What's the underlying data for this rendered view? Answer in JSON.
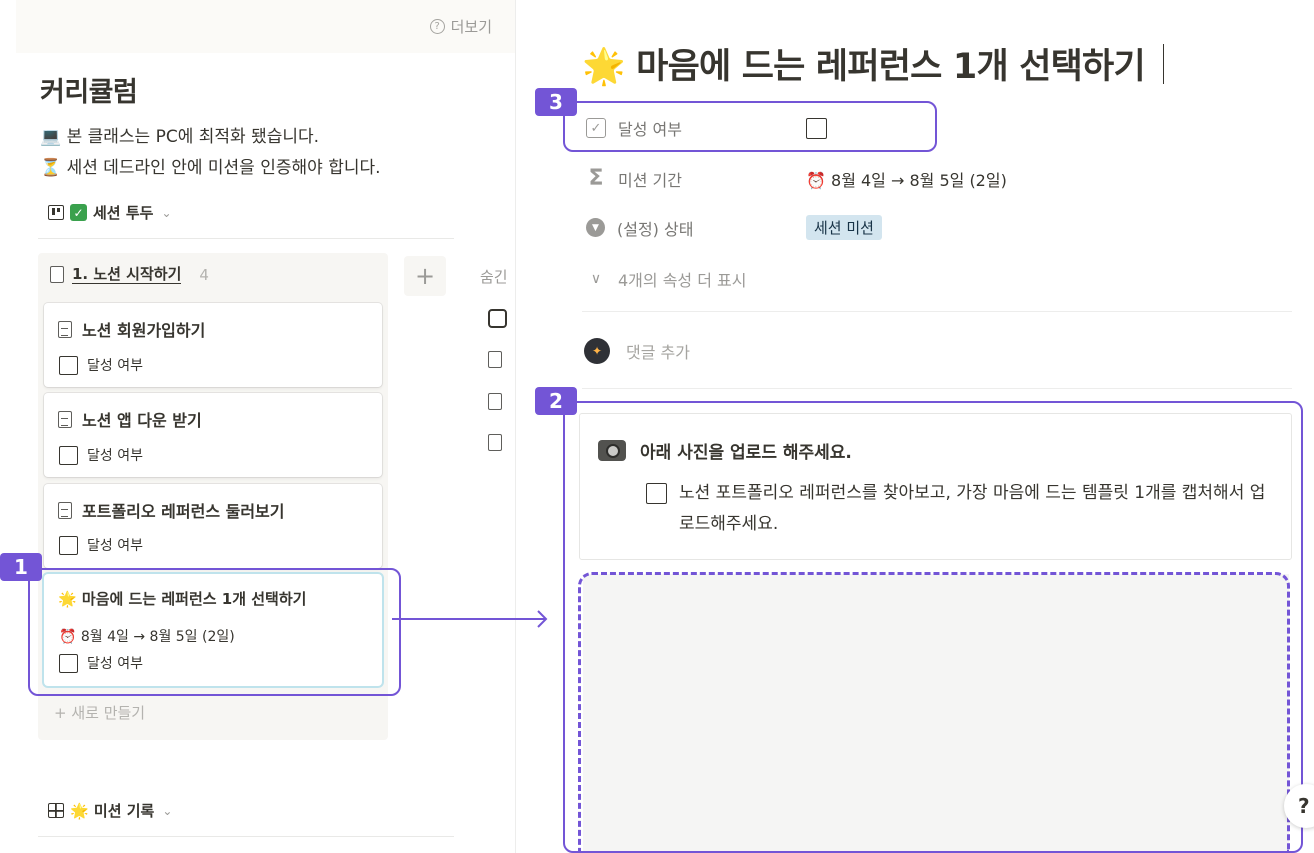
{
  "left": {
    "topbar": {
      "more_label": "더보기"
    },
    "title": "커리큘럼",
    "desc1": "💻 본 클래스는 PC에 최적화 됐습니다.",
    "desc2": "⏳ 세션 데드라인 안에 미션을 인증해야 합니다.",
    "view1": {
      "label": "세션 투두",
      "icon": "board-icon"
    },
    "view2": {
      "label": "🌟 미션 기록",
      "icon": "gallery-icon"
    },
    "column": {
      "label": "1. 노션 시작하기",
      "count": "4"
    },
    "cards": [
      {
        "title": "노션 회원가입하기",
        "prop": "달성 여부"
      },
      {
        "title": "노션 앱 다운 받기",
        "prop": "달성 여부"
      },
      {
        "title": "포트폴리오 레퍼런스 둘러보기",
        "prop": "달성 여부"
      },
      {
        "title": "🌟 마음에 드는 레퍼런스 1개 선택하기",
        "date": "⏰ 8월 4일 → 8월 5일 (2일)",
        "prop": "달성 여부"
      }
    ],
    "new_label": "+ 새로 만들기",
    "hidden_label": "숨긴"
  },
  "annotations": {
    "b1": "1",
    "b2": "2",
    "b3": "3",
    "accent": "#7355d6"
  },
  "right": {
    "title": "🌟 마음에 드는 레퍼런스 1개 선택하기",
    "props": [
      {
        "name": "달성 여부"
      },
      {
        "name": "미션 기간",
        "value": "⏰ 8월 4일 → 8월 5일 (2일)"
      },
      {
        "name": "(설정) 상태",
        "value": "세션 미션"
      },
      {
        "name": "4개의 속성 더 표시"
      }
    ],
    "comment_placeholder": "댓글 추가",
    "callout": {
      "heading": "아래 사진을 업로드 해주세요.",
      "todo": "노션 포트폴리오 레퍼런스를 찾아보고, 가장 마음에 드는 템플릿 1개를 캡처해서 업로드해주세요."
    },
    "help_label": "?"
  }
}
